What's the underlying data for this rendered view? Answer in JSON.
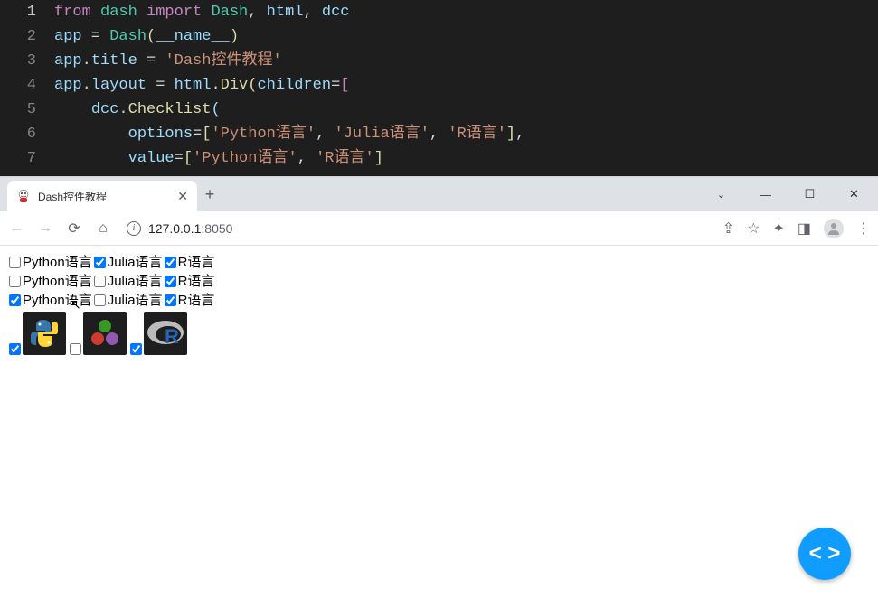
{
  "editor": {
    "lines": [
      {
        "num": "1"
      },
      {
        "num": "2"
      },
      {
        "num": "3"
      },
      {
        "num": "4"
      },
      {
        "num": "5"
      },
      {
        "num": "6"
      },
      {
        "num": "7"
      }
    ],
    "l1_from": "from",
    "l1_dash": "dash",
    "l1_import": "import",
    "l1_Dash": "Dash",
    "l1_html": "html",
    "l1_dcc": "dcc",
    "l2_app": "app",
    "l2_eq": " = ",
    "l2_Dash": "Dash",
    "l2_name": "__name__",
    "l3_app": "app",
    "l3_title": "title",
    "l3_str": "'Dash控件教程'",
    "l4_app": "app",
    "l4_layout": "layout",
    "l4_html": "html",
    "l4_Div": "Div",
    "l4_children": "children",
    "l5_dcc": "dcc",
    "l5_Checklist": "Checklist",
    "l6_options": "options",
    "l6_s1": "'Python语言'",
    "l6_s2": "'Julia语言'",
    "l6_s3": "'R语言'",
    "l7_value": "value",
    "l7_s1": "'Python语言'",
    "l7_s2": "'R语言'"
  },
  "browser": {
    "tab_title": "Dash控件教程",
    "url_host": "127.0.0.1",
    "url_port": ":8050"
  },
  "page": {
    "row1": [
      {
        "label": "Python语言",
        "checked": false
      },
      {
        "label": "Julia语言",
        "checked": true
      },
      {
        "label": "R语言",
        "checked": true
      }
    ],
    "row2": [
      {
        "label": "Python语言",
        "checked": false
      },
      {
        "label": "Julia语言",
        "checked": false
      },
      {
        "label": "R语言",
        "checked": true
      }
    ],
    "row3": [
      {
        "label": "Python语言",
        "checked": true
      },
      {
        "label": "Julia语言",
        "checked": false
      },
      {
        "label": "R语言",
        "checked": true
      }
    ],
    "row4": [
      {
        "icon": "python",
        "checked": true
      },
      {
        "icon": "julia",
        "checked": false
      },
      {
        "icon": "r",
        "checked": true
      }
    ],
    "fab": "< >"
  }
}
